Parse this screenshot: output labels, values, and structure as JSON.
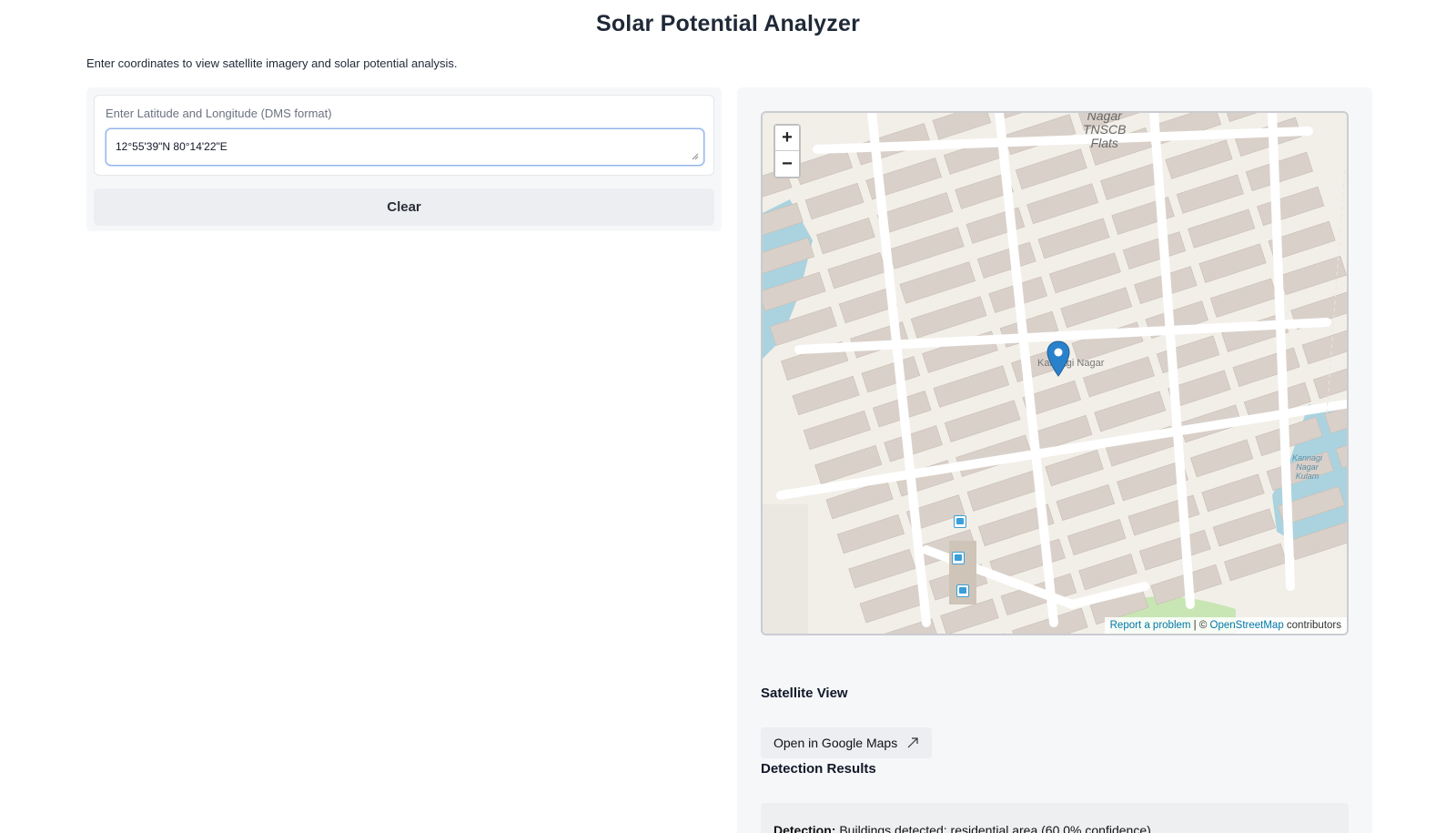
{
  "header": {
    "title": "Solar Potential Analyzer",
    "subtitle": "Enter coordinates to view satellite imagery and solar potential analysis."
  },
  "input_panel": {
    "label": "Enter Latitude and Longitude (DMS format)",
    "value": "12°55'39\"N 80°14'22\"E",
    "clear_label": "Clear"
  },
  "map": {
    "zoom_in": "+",
    "zoom_out": "−",
    "place_label": "Kannagi Nagar",
    "area_label": "Nagar\nTNSCB\nFlats",
    "lake_label": "Kannagi\nNagar\nKulam",
    "attribution": {
      "report": "Report a problem",
      "separator": " | © ",
      "osm": "OpenStreetMap",
      "suffix": " contributors"
    },
    "colors": {
      "land": "#f2efe9",
      "road": "#ffffff",
      "building": "#d9d0c9",
      "water": "#aad3df",
      "marker": "#2a81cb"
    }
  },
  "satellite": {
    "heading": "Satellite View",
    "button_label": "Open in Google Maps",
    "button_icon": "external-link-icon"
  },
  "results": {
    "heading": "Detection Results",
    "detection_label": "Detection:",
    "detection_text": " Buildings detected: residential area (60.0% confidence)"
  }
}
